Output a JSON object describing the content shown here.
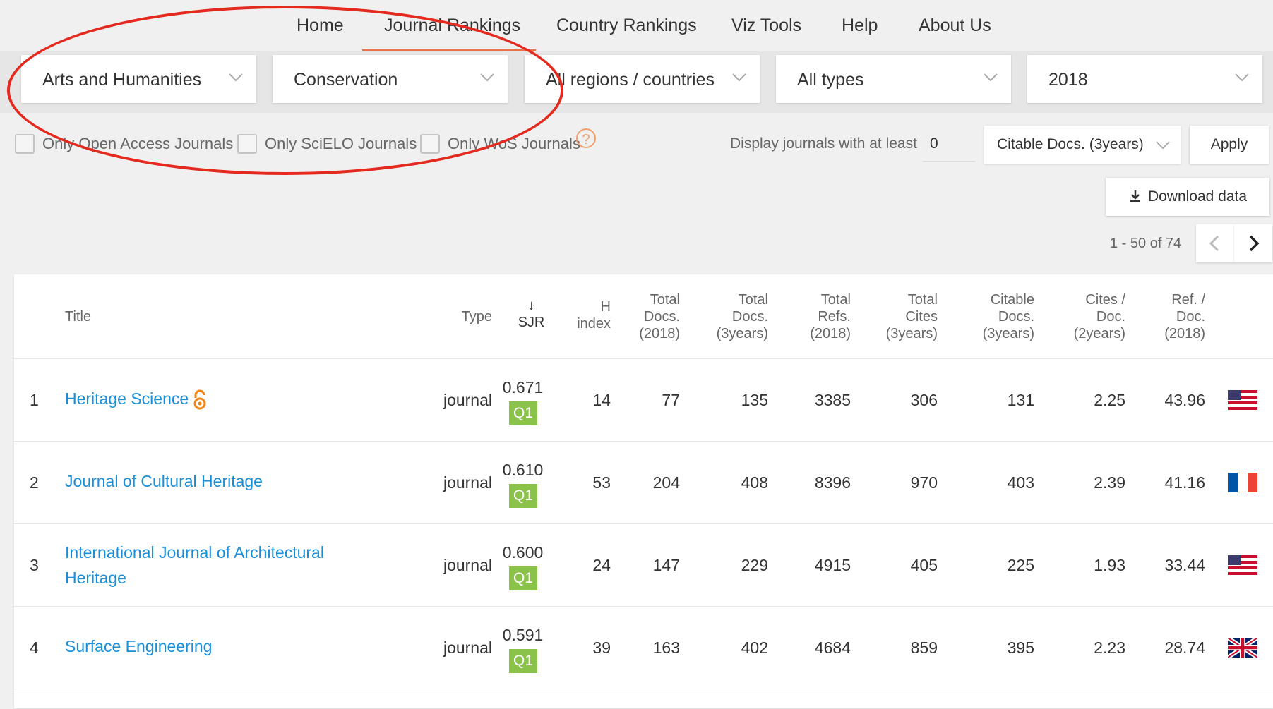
{
  "nav": {
    "items": [
      "Home",
      "Journal Rankings",
      "Country Rankings",
      "Viz Tools",
      "Help",
      "About Us"
    ],
    "active": "Journal Rankings"
  },
  "filters": {
    "area": "Arts and Humanities",
    "category": "Conservation",
    "region": "All regions / countries",
    "type": "All types",
    "year": "2018"
  },
  "options": {
    "open_access": "Only Open Access Journals",
    "scielo": "Only SciELO Journals",
    "wos": "Only WoS Journals",
    "help_icon": "?"
  },
  "threshold": {
    "label": "Display journals with at least",
    "value": "0",
    "metric": "Citable Docs. (3years)",
    "apply": "Apply"
  },
  "download": {
    "label": "Download data"
  },
  "pagination": {
    "text": "1 - 50 of 74"
  },
  "table": {
    "headers": {
      "title": "Title",
      "type": "Type",
      "sort_arrow": "↓",
      "sjr": "SJR",
      "h1": "H",
      "h2": "index",
      "td1": "Total",
      "td2": "Docs.",
      "td3": "(2018)",
      "t3_1": "Total",
      "t3_2": "Docs.",
      "t3_3": "(3years)",
      "tr1": "Total",
      "tr2": "Refs.",
      "tr3": "(2018)",
      "tc1": "Total",
      "tc2": "Cites",
      "tc3": "(3years)",
      "cd1": "Citable",
      "cd2": "Docs.",
      "cd3": "(3years)",
      "cp1": "Cites /",
      "cp2": "Doc.",
      "cp3": "(2years)",
      "rd1": "Ref. /",
      "rd2": "Doc.",
      "rd3": "(2018)"
    },
    "rows": [
      {
        "rank": "1",
        "title": "Heritage Science",
        "type": "journal",
        "sjr": "0.671",
        "quartile": "Q1",
        "h_index": "14",
        "total_docs_2018": "77",
        "total_docs_3y": "135",
        "total_refs": "3385",
        "total_cites_3y": "306",
        "citable_docs_3y": "131",
        "cites_per_doc": "2.25",
        "ref_per_doc": "43.96",
        "country_flag": "us-flag-icon"
      },
      {
        "rank": "2",
        "title": "Journal of Cultural Heritage",
        "type": "journal",
        "sjr": "0.610",
        "quartile": "Q1",
        "h_index": "53",
        "total_docs_2018": "204",
        "total_docs_3y": "408",
        "total_refs": "8396",
        "total_cites_3y": "970",
        "citable_docs_3y": "403",
        "cites_per_doc": "2.39",
        "ref_per_doc": "41.16",
        "country_flag": "fr-flag-icon"
      },
      {
        "rank": "3",
        "title_line1": "International Journal of Architectural",
        "title_line2": "Heritage",
        "type": "journal",
        "sjr": "0.600",
        "quartile": "Q1",
        "h_index": "24",
        "total_docs_2018": "147",
        "total_docs_3y": "229",
        "total_refs": "4915",
        "total_cites_3y": "405",
        "citable_docs_3y": "225",
        "cites_per_doc": "1.93",
        "ref_per_doc": "33.44",
        "country_flag": "us-flag-icon"
      },
      {
        "rank": "4",
        "title": "Surface Engineering",
        "type": "journal",
        "sjr": "0.591",
        "quartile": "Q1",
        "h_index": "39",
        "total_docs_2018": "163",
        "total_docs_3y": "402",
        "total_refs": "4684",
        "total_cites_3y": "859",
        "citable_docs_3y": "395",
        "cites_per_doc": "2.23",
        "ref_per_doc": "28.74",
        "country_flag": "gb-flag-icon"
      }
    ]
  },
  "colors": {
    "accent": "#e8734a",
    "link": "#1a8fd8",
    "quartile_q1": "#8bc34a",
    "annotation": "#e42a1e"
  }
}
